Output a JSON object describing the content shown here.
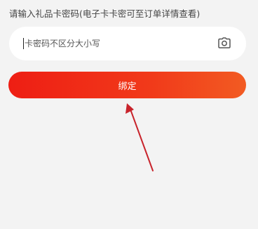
{
  "form": {
    "instruction": "请输入礼品卡密码(电子卡卡密可至订单详情查看)",
    "input_placeholder": "卡密码不区分大小写",
    "input_value": "",
    "camera_icon": "camera-icon",
    "bind_button_label": "绑定"
  },
  "colors": {
    "background": "#f3f3f3",
    "button_start": "#ee1e14",
    "button_end": "#f25b22",
    "annotation_arrow": "#c8232b"
  }
}
